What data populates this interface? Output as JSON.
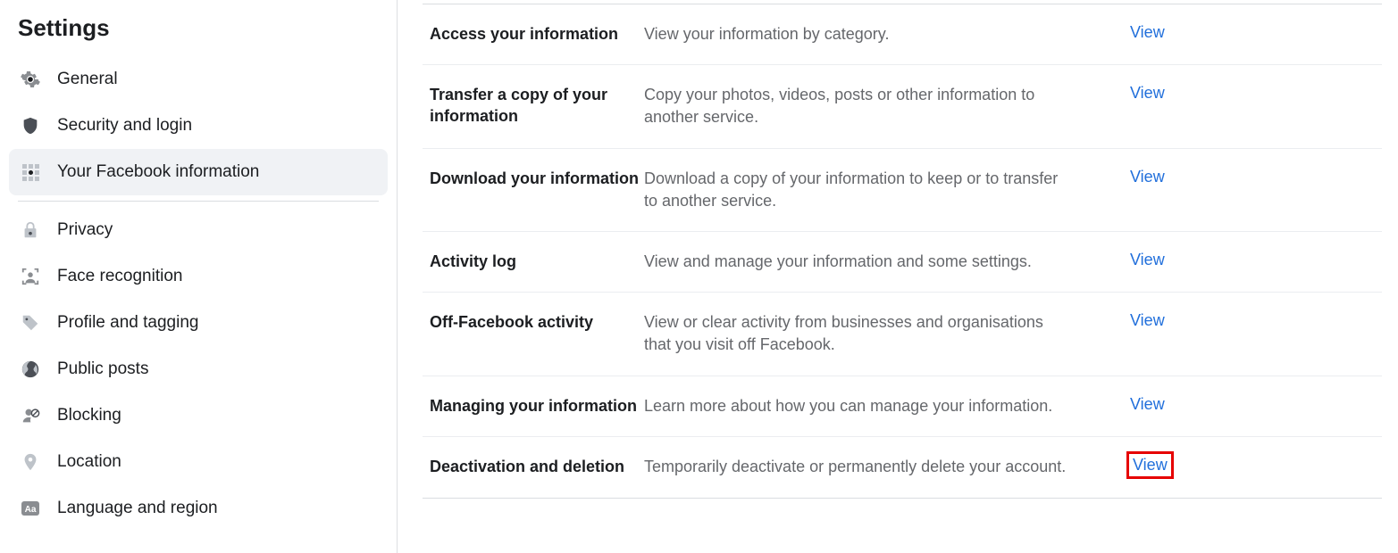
{
  "sidebar": {
    "title": "Settings",
    "items": [
      {
        "label": "General"
      },
      {
        "label": "Security and login"
      },
      {
        "label": "Your Facebook information"
      },
      {
        "label": "Privacy"
      },
      {
        "label": "Face recognition"
      },
      {
        "label": "Profile and tagging"
      },
      {
        "label": "Public posts"
      },
      {
        "label": "Blocking"
      },
      {
        "label": "Location"
      },
      {
        "label": "Language and region"
      }
    ]
  },
  "rows": [
    {
      "title": "Access your information",
      "desc": "View your information by category.",
      "action": "View"
    },
    {
      "title": "Transfer a copy of your information",
      "desc": "Copy your photos, videos, posts or other information to another service.",
      "action": "View"
    },
    {
      "title": "Download your information",
      "desc": "Download a copy of your information to keep or to transfer to another service.",
      "action": "View"
    },
    {
      "title": "Activity log",
      "desc": "View and manage your information and some settings.",
      "action": "View"
    },
    {
      "title": "Off-Facebook activity",
      "desc": "View or clear activity from businesses and organisations that you visit off Facebook.",
      "action": "View"
    },
    {
      "title": "Managing your information",
      "desc": "Learn more about how you can manage your information.",
      "action": "View"
    },
    {
      "title": "Deactivation and deletion",
      "desc": "Temporarily deactivate or permanently delete your account.",
      "action": "View"
    }
  ]
}
